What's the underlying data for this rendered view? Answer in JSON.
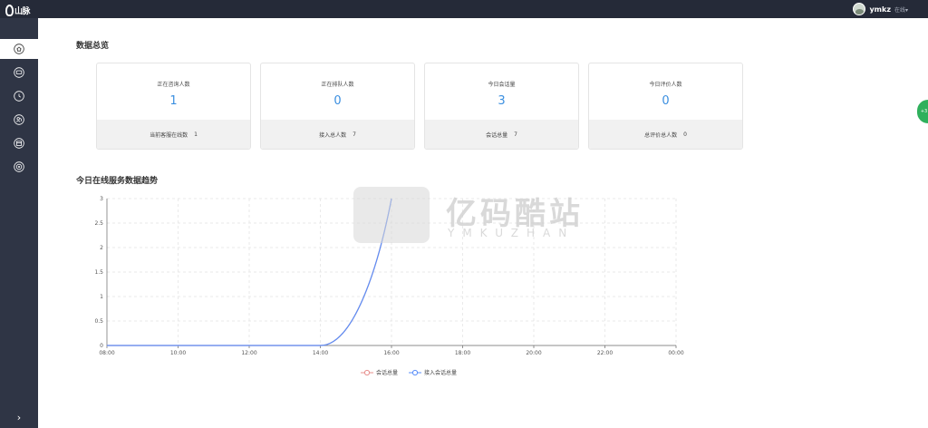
{
  "header": {
    "logo_text": "山脉",
    "user_name": "ymkz",
    "user_status": "在线▾"
  },
  "sidebar": {
    "items": [
      {
        "icon": "home-icon"
      },
      {
        "icon": "chat-icon"
      },
      {
        "icon": "history-icon"
      },
      {
        "icon": "users-icon"
      },
      {
        "icon": "calendar-icon"
      },
      {
        "icon": "settings-icon"
      }
    ],
    "expand_glyph": "›"
  },
  "overview": {
    "title": "数据总览",
    "cards": [
      {
        "label": "正在咨询人数",
        "value": "1",
        "foot_label": "当前客服在线数",
        "foot_value": "1"
      },
      {
        "label": "正在排队人数",
        "value": "0",
        "foot_label": "接入总人数",
        "foot_value": "7"
      },
      {
        "label": "今日会话量",
        "value": "3",
        "foot_label": "会话总量",
        "foot_value": "7"
      },
      {
        "label": "今日评价人数",
        "value": "0",
        "foot_label": "总评价总人数",
        "foot_value": "0"
      }
    ]
  },
  "trend": {
    "title": "今日在线服务数据趋势"
  },
  "watermark": {
    "main": "亿码酷站",
    "sub": "YMKUZHAN"
  },
  "float_badge": "+3",
  "colors": {
    "accent": "#3b8fe0",
    "series_total": "#e7908e",
    "series_access": "#5b8ff9",
    "sidebar": "#2f3545",
    "topbar": "#252a38"
  },
  "chart_data": {
    "type": "line",
    "x": [
      "08:00",
      "10:00",
      "12:00",
      "14:00",
      "16:00",
      "18:00",
      "20:00",
      "22:00",
      "00:00"
    ],
    "ylim": [
      0,
      3
    ],
    "yticks": [
      "0",
      "0.5",
      "1",
      "1.5",
      "2",
      "2.5",
      "3"
    ],
    "grid": true,
    "legend_position": "bottom-center",
    "series": [
      {
        "name": "会话总量",
        "color": "#e7908e",
        "points": [
          [
            "08:00",
            0
          ],
          [
            "14:00",
            0
          ],
          [
            "16:00",
            3
          ]
        ]
      },
      {
        "name": "接入会话总量",
        "color": "#5b8ff9",
        "points": [
          [
            "08:00",
            0
          ],
          [
            "14:00",
            0
          ],
          [
            "16:00",
            3
          ]
        ]
      }
    ]
  }
}
